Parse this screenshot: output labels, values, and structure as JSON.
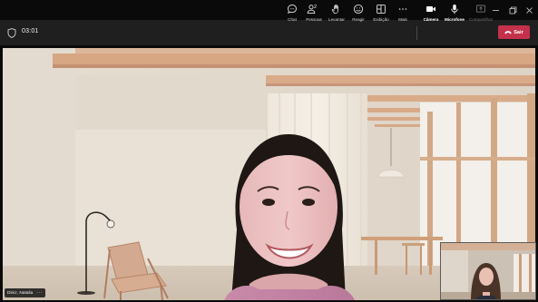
{
  "window": {
    "controls": [
      "minimize",
      "maximize",
      "close"
    ]
  },
  "meeting": {
    "elapsed_time": "03:01"
  },
  "toolbar": {
    "chat_label": "Chat",
    "people_label": "Pessoas",
    "people_count": "2",
    "raise_label": "Levantar",
    "react_label": "Reagir",
    "rooms_label": "Exibição",
    "more_label": "Mais",
    "camera_label": "Câmera",
    "mic_label": "Microfone",
    "share_label": "Compartilhar",
    "leave_label": "Sair"
  },
  "participant": {
    "name": "Diniz, Natalia",
    "more": "···"
  },
  "colors": {
    "leave_button": "#c4314b",
    "toolbar_bg": "#1f1f1f",
    "titlebar_bg": "#0a0a0a"
  },
  "icons": [
    "shield-icon",
    "chat-icon",
    "people-icon",
    "raise-hand-icon",
    "react-icon",
    "view-icon",
    "more-icon",
    "camera-icon",
    "microphone-icon",
    "share-icon",
    "phone-icon"
  ]
}
